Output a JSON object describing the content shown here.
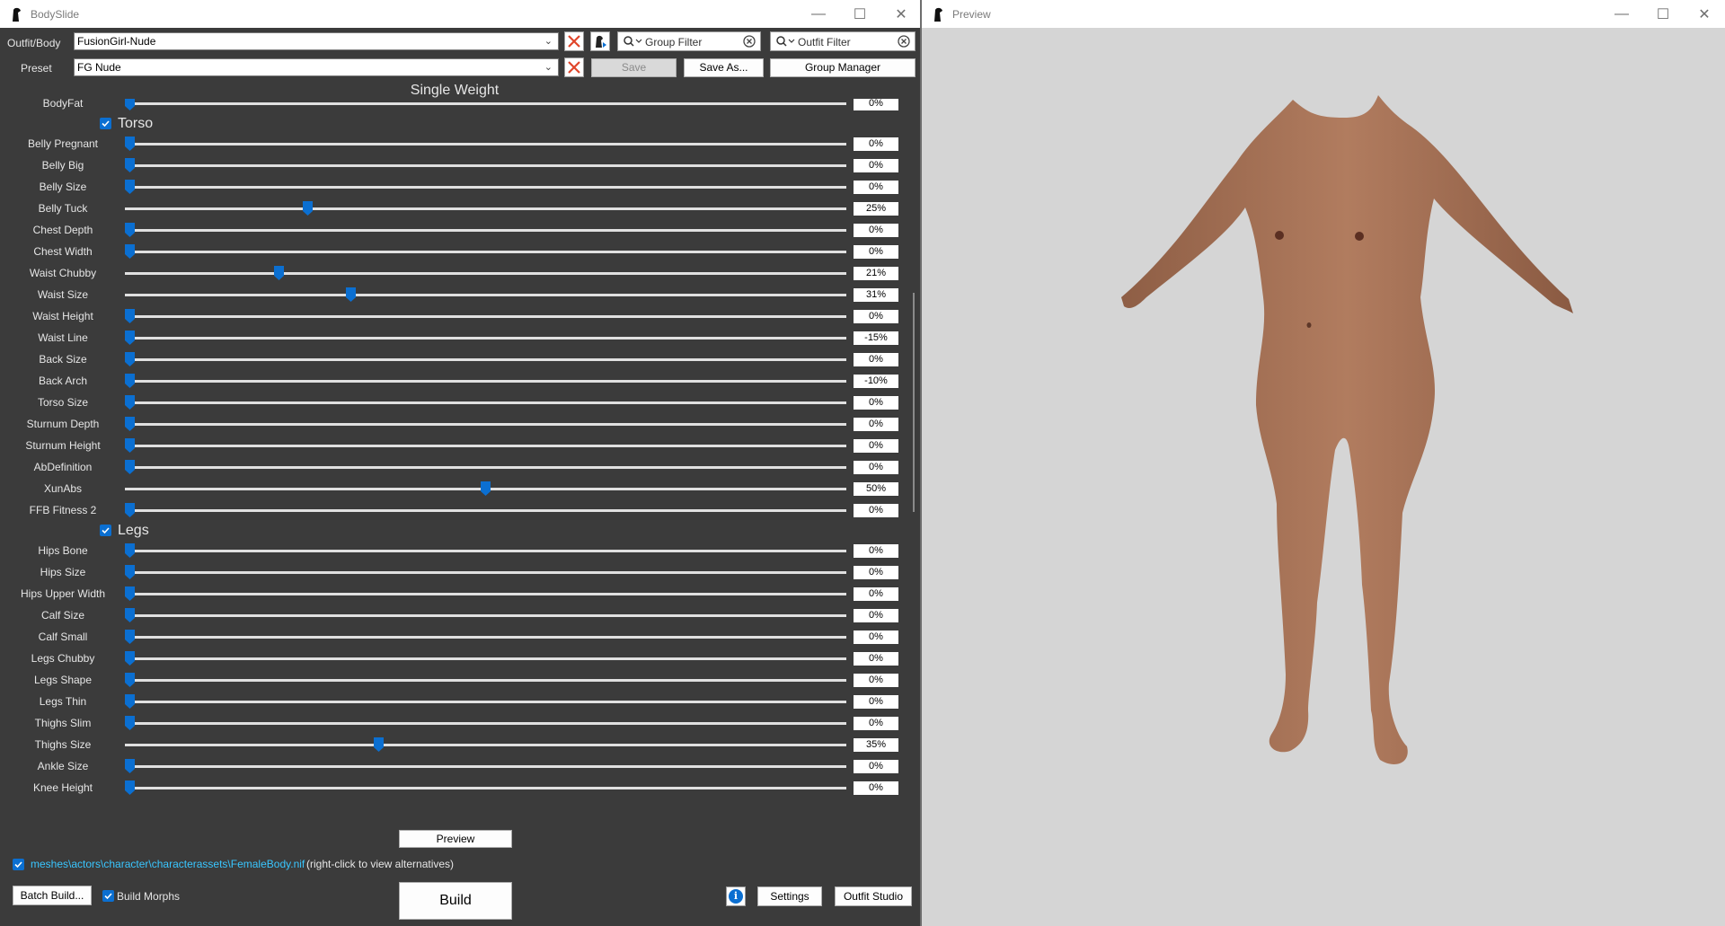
{
  "left_window": {
    "title": "BodySlide",
    "controls": {
      "minimize": "—",
      "maximize": "☐",
      "close": "✕"
    },
    "toolbar": {
      "outfit_label": "Outfit/Body",
      "outfit_value": "FusionGirl-Nude",
      "preset_label": "Preset",
      "preset_value": "FG Nude",
      "group_filter": "Group Filter",
      "outfit_filter": "Outfit Filter",
      "save_label": "Save",
      "save_as_label": "Save As...",
      "group_manager_label": "Group Manager"
    },
    "heading": "Single Weight",
    "top_partial_row": {
      "name": "BodyFat",
      "value": "0%",
      "level": 0
    },
    "groups": [
      {
        "name": "Torso",
        "checked": true,
        "sliders": [
          {
            "name": "Belly Pregnant",
            "value": "0%",
            "level": 0
          },
          {
            "name": "Belly Big",
            "value": "0%",
            "level": 0
          },
          {
            "name": "Belly Size",
            "value": "0%",
            "level": 0
          },
          {
            "name": "Belly Tuck",
            "value": "25%",
            "level": 25
          },
          {
            "name": "Chest Depth",
            "value": "0%",
            "level": 0
          },
          {
            "name": "Chest Width",
            "value": "0%",
            "level": 0
          },
          {
            "name": "Waist Chubby",
            "value": "21%",
            "level": 21
          },
          {
            "name": "Waist Size",
            "value": "31%",
            "level": 31
          },
          {
            "name": "Waist Height",
            "value": "0%",
            "level": 0
          },
          {
            "name": "Waist Line",
            "value": "-15%",
            "level": 0
          },
          {
            "name": "Back Size",
            "value": "0%",
            "level": 0
          },
          {
            "name": "Back Arch",
            "value": "-10%",
            "level": 0
          },
          {
            "name": "Torso Size",
            "value": "0%",
            "level": 0
          },
          {
            "name": "Sturnum Depth",
            "value": "0%",
            "level": 0
          },
          {
            "name": "Sturnum Height",
            "value": "0%",
            "level": 0
          },
          {
            "name": "AbDefinition",
            "value": "0%",
            "level": 0
          },
          {
            "name": "XunAbs",
            "value": "50%",
            "level": 50
          },
          {
            "name": "FFB Fitness 2",
            "value": "0%",
            "level": 0
          }
        ]
      },
      {
        "name": "Legs",
        "checked": true,
        "sliders": [
          {
            "name": "Hips Bone",
            "value": "0%",
            "level": 0
          },
          {
            "name": "Hips Size",
            "value": "0%",
            "level": 0
          },
          {
            "name": "Hips Upper Width",
            "value": "0%",
            "level": 0
          },
          {
            "name": "Calf Size",
            "value": "0%",
            "level": 0
          },
          {
            "name": "Calf Small",
            "value": "0%",
            "level": 0
          },
          {
            "name": "Legs Chubby",
            "value": "0%",
            "level": 0
          },
          {
            "name": "Legs Shape",
            "value": "0%",
            "level": 0
          },
          {
            "name": "Legs Thin",
            "value": "0%",
            "level": 0
          },
          {
            "name": "Thighs Slim",
            "value": "0%",
            "level": 0
          },
          {
            "name": "Thighs Size",
            "value": "35%",
            "level": 35
          },
          {
            "name": "Ankle Size",
            "value": "0%",
            "level": 0
          },
          {
            "name": "Knee Height",
            "value": "0%",
            "level": 0
          }
        ]
      }
    ],
    "bottom": {
      "preview_label": "Preview",
      "nif_path": "meshes\\actors\\character\\characterassets\\FemaleBody.nif",
      "nif_hint": "(right-click to view alternatives)",
      "batch_build_label": "Batch Build...",
      "build_morphs_label": "Build Morphs",
      "build_morphs_checked": true,
      "build_label": "Build",
      "info_label": "i",
      "settings_label": "Settings",
      "outfit_studio_label": "Outfit Studio"
    }
  },
  "right_window": {
    "title": "Preview",
    "controls": {
      "minimize": "—",
      "maximize": "☐",
      "close": "✕"
    }
  },
  "colors": {
    "panel_bg": "#3b3b3b",
    "accent": "#0b6fd1",
    "link": "#39c6ff",
    "preview_bg": "#d5d5d5",
    "skin": "#a37055"
  },
  "icons": [
    "bodyslide-app-icon",
    "remove-icon",
    "export-icon",
    "search-dropdown-icon",
    "clear-icon",
    "checkbox-checked-icon",
    "info-icon"
  ]
}
